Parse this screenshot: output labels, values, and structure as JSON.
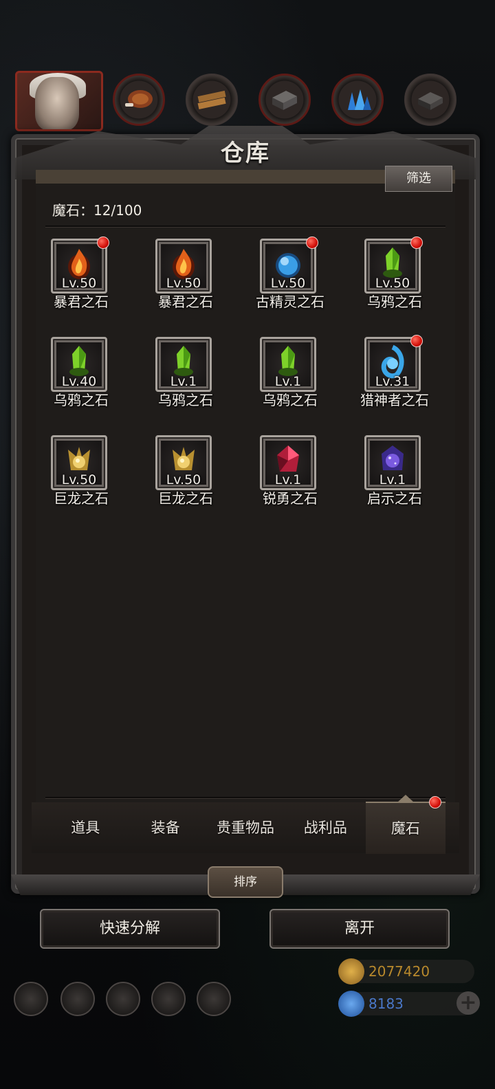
{
  "panel": {
    "title": "仓库",
    "filter_label": "筛选",
    "count_label": "魔石：12/100"
  },
  "items": [
    {
      "level": "Lv.50",
      "name": "暴君之石",
      "gem": "fire",
      "dot": true
    },
    {
      "level": "Lv.50",
      "name": "暴君之石",
      "gem": "fire",
      "dot": false
    },
    {
      "level": "Lv.50",
      "name": "古精灵之石",
      "gem": "blue-orb",
      "dot": true
    },
    {
      "level": "Lv.50",
      "name": "乌鸦之石",
      "gem": "green",
      "dot": true
    },
    {
      "level": "Lv.40",
      "name": "乌鸦之石",
      "gem": "green",
      "dot": false
    },
    {
      "level": "Lv.1",
      "name": "乌鸦之石",
      "gem": "green",
      "dot": false
    },
    {
      "level": "Lv.1",
      "name": "乌鸦之石",
      "gem": "green",
      "dot": false
    },
    {
      "level": "Lv.31",
      "name": "猎神者之石",
      "gem": "blue-swirl",
      "dot": true
    },
    {
      "level": "Lv.50",
      "name": "巨龙之石",
      "gem": "gold",
      "dot": false
    },
    {
      "level": "Lv.50",
      "name": "巨龙之石",
      "gem": "gold",
      "dot": false
    },
    {
      "level": "Lv.1",
      "name": "锐勇之石",
      "gem": "red",
      "dot": false
    },
    {
      "level": "Lv.1",
      "name": "启示之石",
      "gem": "purple",
      "dot": false
    }
  ],
  "tabs": [
    {
      "label": "道具",
      "active": false
    },
    {
      "label": "装备",
      "active": false
    },
    {
      "label": "贵重物品",
      "active": false
    },
    {
      "label": "战利品",
      "active": false
    },
    {
      "label": "魔石",
      "active": true
    }
  ],
  "buttons": {
    "sort": "排序",
    "quick_decompose": "快速分解",
    "leave": "离开"
  },
  "currency": {
    "gold": "2077420",
    "gems": "8183"
  },
  "colors": {
    "red_dot": "#d4110a",
    "gold_text": "#b8892c",
    "gem_text": "#4a78c8"
  },
  "top_icons": [
    "avatar",
    "meat-icon",
    "wood-icon",
    "iron-icon",
    "crystal-icon",
    "ore-icon"
  ]
}
